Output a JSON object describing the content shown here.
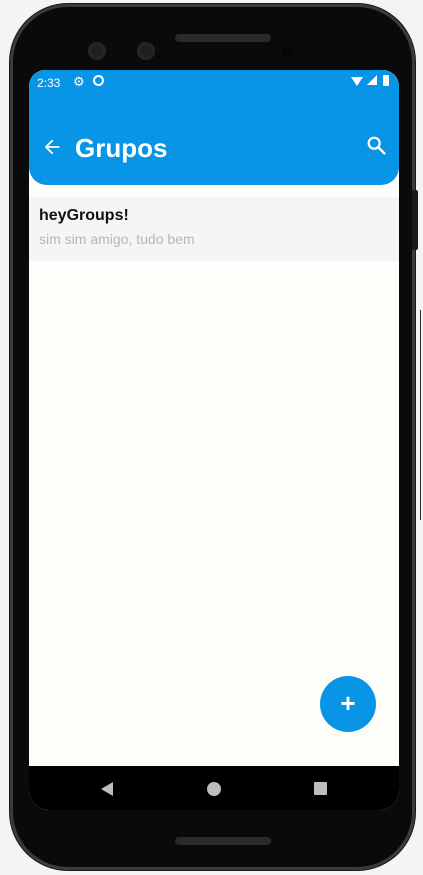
{
  "status_bar": {
    "time": "2:33",
    "icons": [
      "gear-icon",
      "sync-icon",
      "wifi-icon",
      "signal-icon",
      "battery-icon"
    ]
  },
  "app_bar": {
    "title": "Grupos",
    "back_icon": "arrow-left-icon",
    "search_icon": "search-icon",
    "color": "#0895e6"
  },
  "groups": [
    {
      "name": "heyGroups!",
      "last_message": "sim sim amigo, tudo bem"
    }
  ],
  "fab": {
    "label": "+",
    "color": "#0895e6"
  },
  "nav_bar": {
    "icons": [
      "back-triangle-icon",
      "home-circle-icon",
      "recents-square-icon"
    ]
  }
}
